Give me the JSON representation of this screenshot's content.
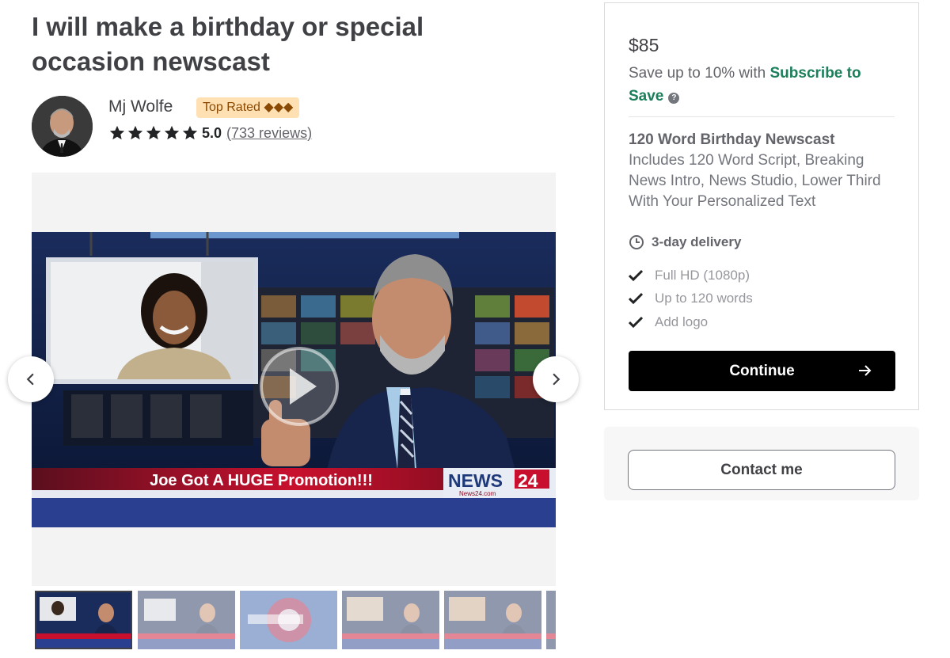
{
  "gig": {
    "title": "I will make a birthday or special occasion newscast"
  },
  "seller": {
    "name": "Mj Wolfe",
    "badge": "Top Rated ◆◆◆",
    "rating": "5.0",
    "reviews": "(733 reviews)",
    "stars": 5
  },
  "media": {
    "lower_third": "Joe Got A HUGE Promotion!!!",
    "logo_news": "NEWS",
    "logo_num": "24",
    "logo_url": "News24.com",
    "thumbnail_count": 5,
    "active_thumbnail": 1
  },
  "package": {
    "price": "$85",
    "subscribe_prefix": "Save up to 10% with ",
    "subscribe_link": "Subscribe to Save",
    "name": "120 Word Birthday Newscast",
    "description": "Includes 120 Word Script, Breaking News Intro, News Studio, Lower Third With Your Personalized Text",
    "delivery": "3-day delivery",
    "features": [
      "Full HD (1080p)",
      "Up to 120 words",
      "Add logo"
    ],
    "continue_label": "Continue",
    "contact_label": "Contact me"
  },
  "colors": {
    "accent_green": "#1a7f5a",
    "badge_bg": "#ffe0b3",
    "badge_text": "#8b4a04",
    "button_black": "#000000"
  },
  "icons": {
    "help": "question-circle-icon",
    "delivery": "clock-icon",
    "feature": "checkmark-icon",
    "continue": "arrow-right-icon",
    "prev": "chevron-left-icon",
    "next": "chevron-right-icon",
    "play": "play-icon"
  }
}
